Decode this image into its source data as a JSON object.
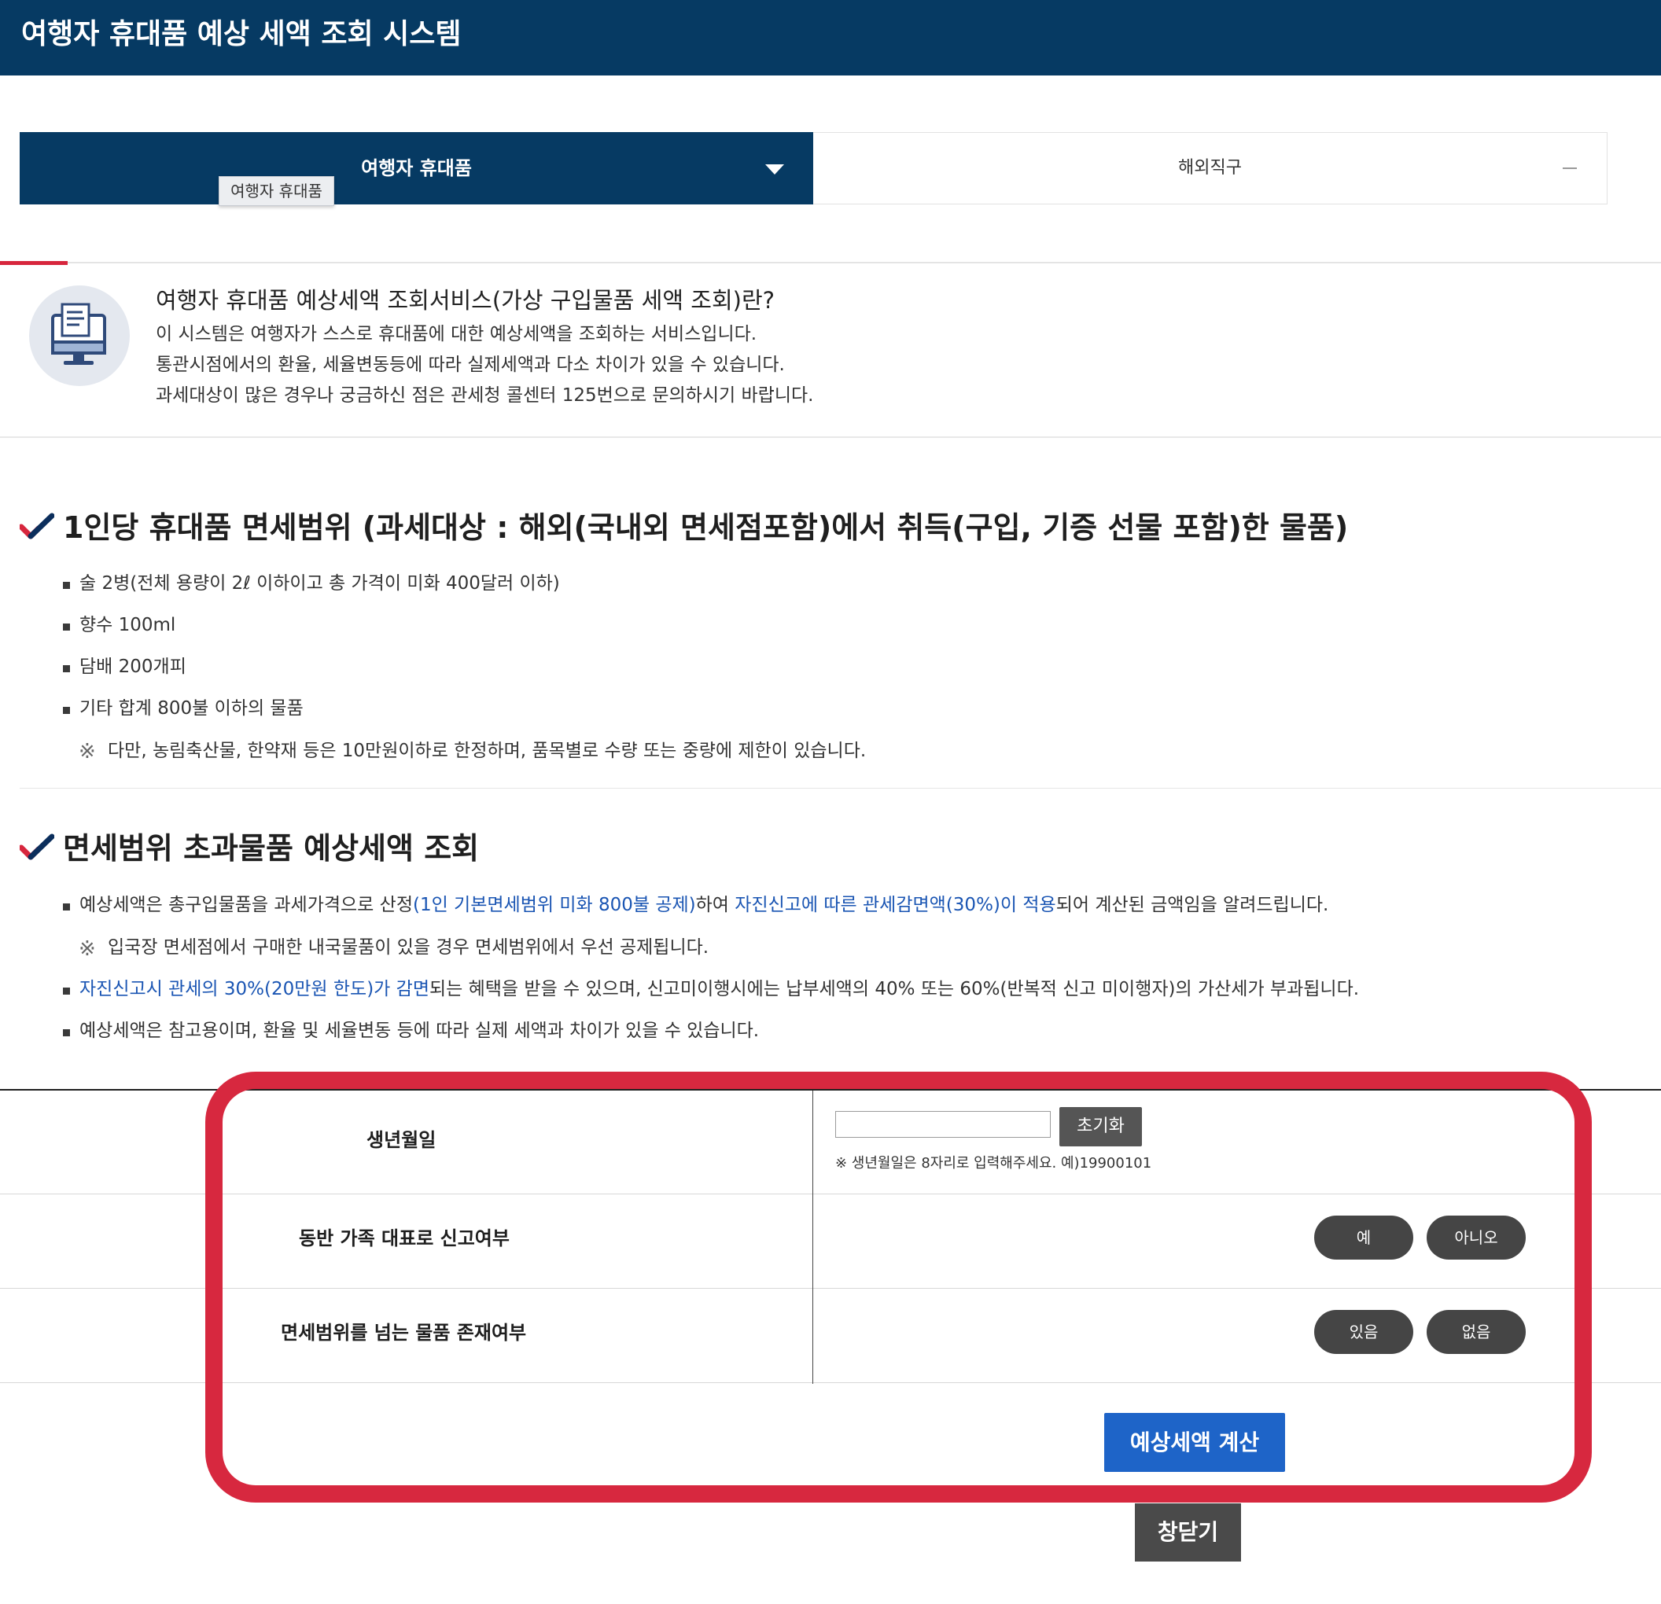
{
  "header": {
    "title": "여행자 휴대품 예상 세액 조회 시스템"
  },
  "tabs": {
    "active_label": "여행자 휴대품",
    "active_tooltip": "여행자 휴대품",
    "second_label": "해외직구"
  },
  "intro": {
    "icon": "computer-document-icon",
    "title": "여행자 휴대품 예상세액 조회서비스(가상 구입물품 세액 조회)란?",
    "lines": [
      "이 시스템은 여행자가 스스로 휴대품에 대한 예상세액을 조회하는 서비스입니다.",
      "통관시점에서의 환율, 세율변동등에 따라 실제세액과 다소 차이가 있을 수 있습니다.",
      "과세대상이 많은 경우나 궁금하신 점은 관세청 콜센터 125번으로 문의하시기 바랍니다."
    ]
  },
  "section1": {
    "title": "1인당 휴대품 면세범위 (과세대상 : 해외(국내외 면세점포함)에서 취득(구입, 기증 선물 포함)한 물품)",
    "items": [
      "술 2병(전체 용량이 2ℓ 이하이고 총 가격이 미화 400달러 이하)",
      "향수 100ml",
      "담배 200개피",
      "기타 합계 800불 이하의 물품"
    ],
    "note_symbol": "※",
    "note": "다만, 농림축산물, 한약재 등은 10만원이하로 한정하며, 품목별로 수량 또는 중량에 제한이 있습니다."
  },
  "section2": {
    "title": "면세범위 초과물품 예상세액 조회",
    "item1": {
      "part1": "예상세액은 총구입물품을 과세가격으로 산정",
      "link1": "(1인 기본면세범위 미화 800불 공제)",
      "part2": "하여 ",
      "link2": "자진신고에 따른 관세감면액(30%)이 적용",
      "part3": "되어 계산된 금액임을 알려드립니다."
    },
    "note_symbol": "※",
    "note": "입국장 면세점에서 구매한 내국물품이 있을 경우 면세범위에서 우선 공제됩니다.",
    "item2": {
      "link": "자진신고시 관세의 30%(20만원 한도)가 감면",
      "text": "되는 혜택을 받을 수 있으며, 신고미이행시에는 납부세액의 40% 또는 60%(반복적 신고 미이행자)의 가산세가 부과됩니다."
    },
    "item3": "예상세액은 참고용이며, 환율 및 세율변동 등에 따라 실제 세액과 차이가 있을 수 있습니다."
  },
  "form": {
    "birth_label": "생년월일",
    "birth_value": "",
    "reset_label": "초기화",
    "birth_hint": "※ 생년월일은 8자리로 입력해주세요. 예)19900101",
    "family_label": "동반 가족 대표로 신고여부",
    "family_yes": "예",
    "family_no": "아니오",
    "exceed_label": "면세범위를 넘는 물품 존재여부",
    "exceed_yes": "있음",
    "exceed_no": "없음",
    "calc_label": "예상세액 계산",
    "close_label": "창닫기"
  },
  "colors": {
    "header_bg": "#063a63",
    "accent_red": "#d7263d",
    "link_blue": "#1a55b3",
    "calc_button": "#1e64c8"
  }
}
